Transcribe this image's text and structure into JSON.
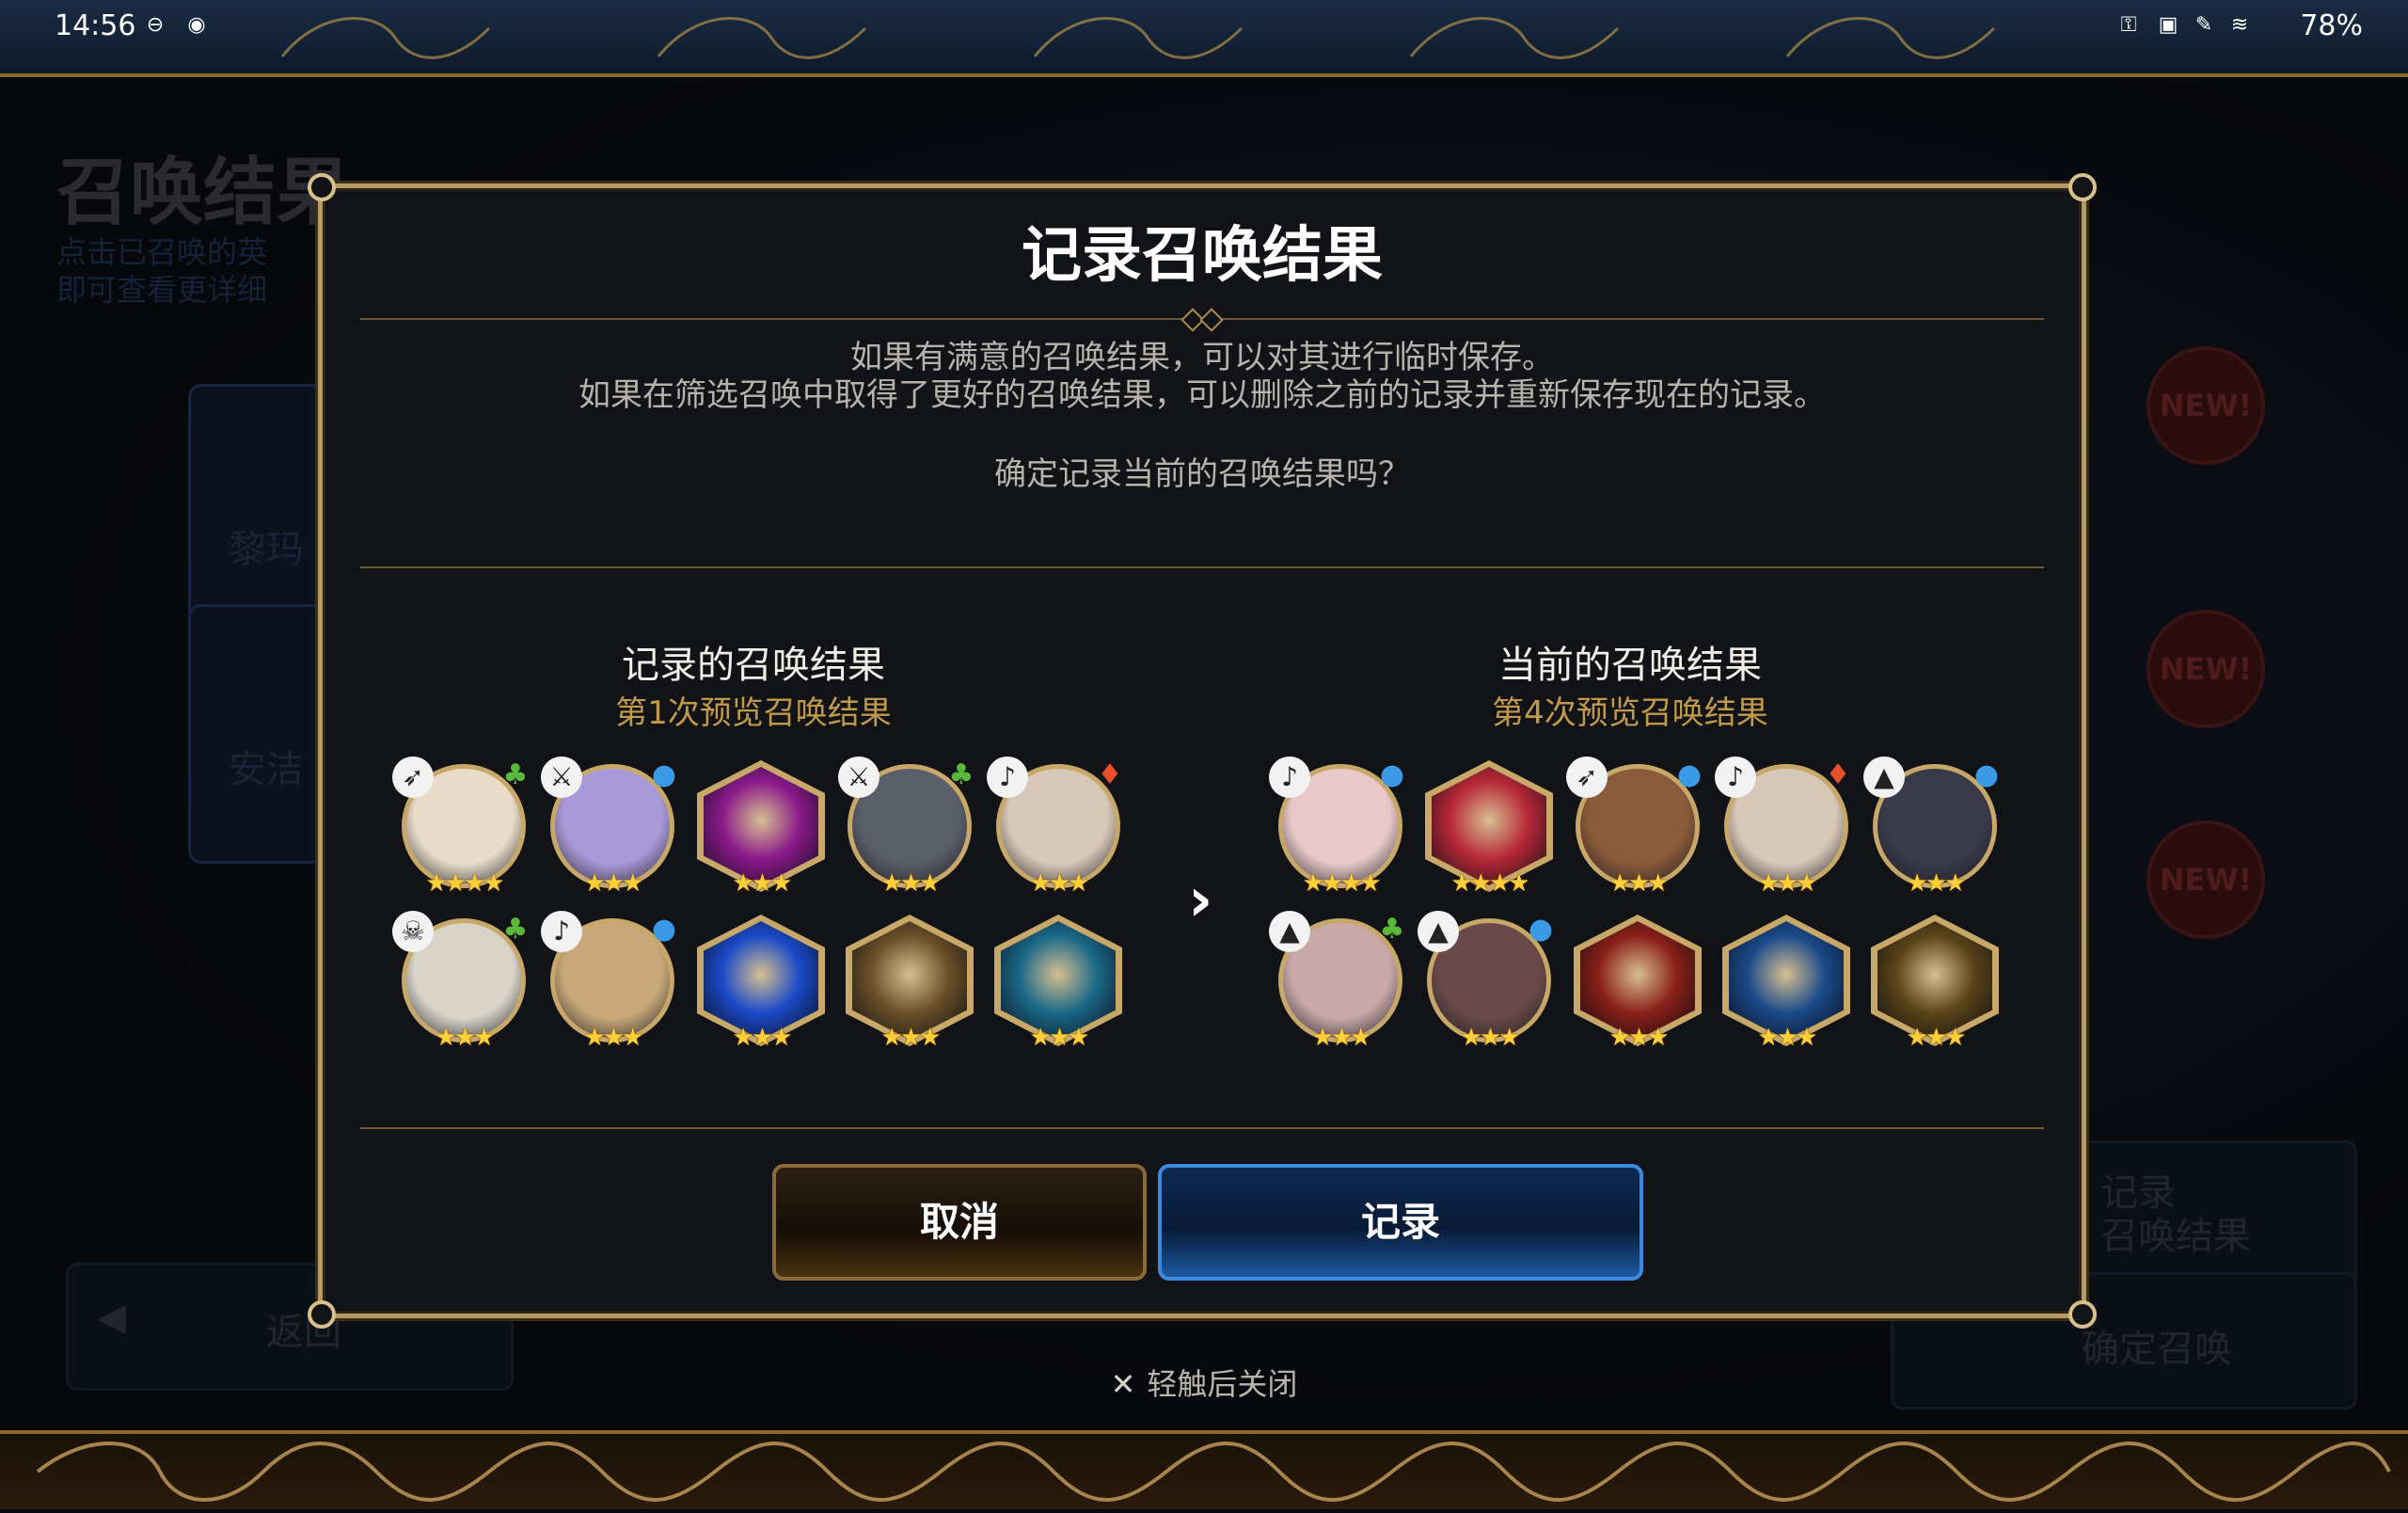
{
  "status_bar": {
    "time": "14:56",
    "battery": "78%"
  },
  "background": {
    "title": "召唤结果",
    "subtitle_lines": [
      "点击已召唤的英",
      "即可查看更详细"
    ],
    "card_labels": [
      "黎玛",
      "安洁"
    ],
    "new_badge": "NEW!",
    "back_label": "返回",
    "record_side_label": "记录\n召唤结果",
    "confirm_summon_label": "确定召唤"
  },
  "dialog": {
    "title": "记录召唤结果",
    "description_lines": [
      "如果有满意的召唤结果，可以对其进行临时保存。",
      "如果在筛选召唤中取得了更好的召唤结果，可以删除之前的记录并重新保存现在的记录。"
    ],
    "confirm_question": "确定记录当前的召唤结果吗？",
    "recorded": {
      "title": "记录的召唤结果",
      "subtitle": "第1次预览召唤结果",
      "units": [
        {
          "kind": "hero",
          "stars": "★★★★",
          "class_icon": "bow-icon",
          "element": "earth",
          "face": "#e8dcc8"
        },
        {
          "kind": "hero",
          "stars": "★★★",
          "class_icon": "sword-icon",
          "element": "water",
          "face": "#a89ad8"
        },
        {
          "kind": "item",
          "stars": "★★★",
          "element": "",
          "face": "#8a1a8a"
        },
        {
          "kind": "hero",
          "stars": "★★★",
          "class_icon": "sword-icon",
          "element": "earth",
          "face": "#5a5e68"
        },
        {
          "kind": "hero",
          "stars": "★★★",
          "class_icon": "staff-icon",
          "element": "fire",
          "face": "#d8c8b8"
        },
        {
          "kind": "hero",
          "stars": "★★★",
          "class_icon": "skull-icon",
          "element": "earth",
          "face": "#d8d4c8"
        },
        {
          "kind": "hero",
          "stars": "★★★",
          "class_icon": "staff-icon",
          "element": "water",
          "face": "#c8a878"
        },
        {
          "kind": "item",
          "stars": "★★★",
          "element": "",
          "face": "#1a4ac8"
        },
        {
          "kind": "item",
          "stars": "★★★",
          "element": "",
          "face": "#6a5028"
        },
        {
          "kind": "item",
          "stars": "★★★",
          "element": "",
          "face": "#1a6888"
        }
      ]
    },
    "current": {
      "title": "当前的召唤结果",
      "subtitle": "第4次预览召唤结果",
      "units": [
        {
          "kind": "hero",
          "stars": "★★★★",
          "class_icon": "staff-icon",
          "element": "water",
          "face": "#e8c8c8"
        },
        {
          "kind": "item",
          "stars": "★★★★",
          "element": "",
          "face": "#b82838"
        },
        {
          "kind": "hero",
          "stars": "★★★",
          "class_icon": "bow-icon",
          "element": "water",
          "face": "#8a5a3a"
        },
        {
          "kind": "hero",
          "stars": "★★★",
          "class_icon": "staff-icon",
          "element": "fire",
          "face": "#d8c8b8"
        },
        {
          "kind": "hero",
          "stars": "★★★",
          "class_icon": "wizard-hat-icon",
          "element": "water",
          "face": "#3a3a4a"
        },
        {
          "kind": "hero",
          "stars": "★★★",
          "class_icon": "wizard-hat-icon",
          "element": "earth",
          "face": "#c8a8a8"
        },
        {
          "kind": "hero",
          "stars": "★★★",
          "class_icon": "wizard-hat-icon",
          "element": "water",
          "face": "#6a4a48"
        },
        {
          "kind": "item",
          "stars": "★★★",
          "element": "",
          "face": "#8a2018"
        },
        {
          "kind": "item",
          "stars": "★★★",
          "element": "",
          "face": "#1a4a8a"
        },
        {
          "kind": "item",
          "stars": "★★★",
          "element": "",
          "face": "#5a4418"
        }
      ]
    },
    "cancel_label": "取消",
    "record_label": "记录"
  },
  "tap_to_close": "轻触后关闭"
}
